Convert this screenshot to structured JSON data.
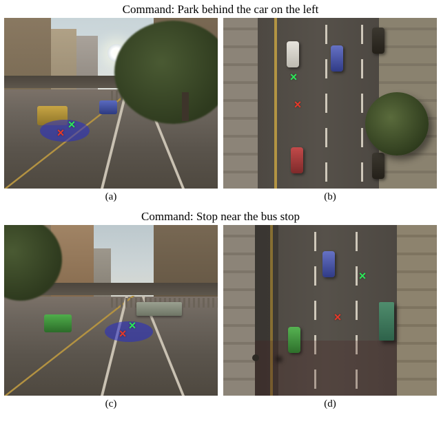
{
  "figure_top": {
    "command_label": "Command: Park behind the car on the left",
    "panels": {
      "a": {
        "label": "(a)"
      },
      "b": {
        "label": "(b)"
      }
    }
  },
  "figure_bottom": {
    "command_label": "Command: Stop near the bus stop",
    "panels": {
      "c": {
        "label": "(c)"
      },
      "d": {
        "label": "(d)"
      }
    }
  },
  "markers": {
    "green_x_symbol": "×",
    "red_x_symbol": "×"
  },
  "colors": {
    "prediction_ellipse": "#2c2cc8",
    "ground_truth": "#2ee65a",
    "prediction_point": "#e53a2a"
  }
}
